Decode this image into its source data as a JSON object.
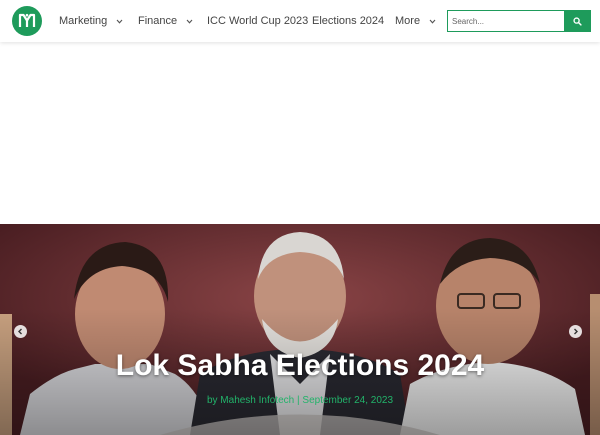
{
  "brand": {
    "color": "#1e9b5b",
    "logo_icon": "mahesh-m-logo"
  },
  "nav": {
    "items": [
      {
        "label": "Marketing",
        "has_dropdown": true
      },
      {
        "label": "Finance",
        "has_dropdown": true
      },
      {
        "label": "ICC World Cup 2023",
        "has_dropdown": false
      },
      {
        "label": "Elections 2024",
        "has_dropdown": false
      },
      {
        "label": "More",
        "has_dropdown": true
      }
    ]
  },
  "search": {
    "placeholder": "Search...",
    "value": "",
    "icon": "search-icon"
  },
  "hero": {
    "title": "Lok Sabha Elections 2024",
    "author_prefix": "by",
    "author": "Mahesh Infotech",
    "separator": "|",
    "date": "September 24, 2023",
    "prev_icon": "chevron-left-icon",
    "next_icon": "chevron-right-icon",
    "meta_color": "#22b36a"
  }
}
